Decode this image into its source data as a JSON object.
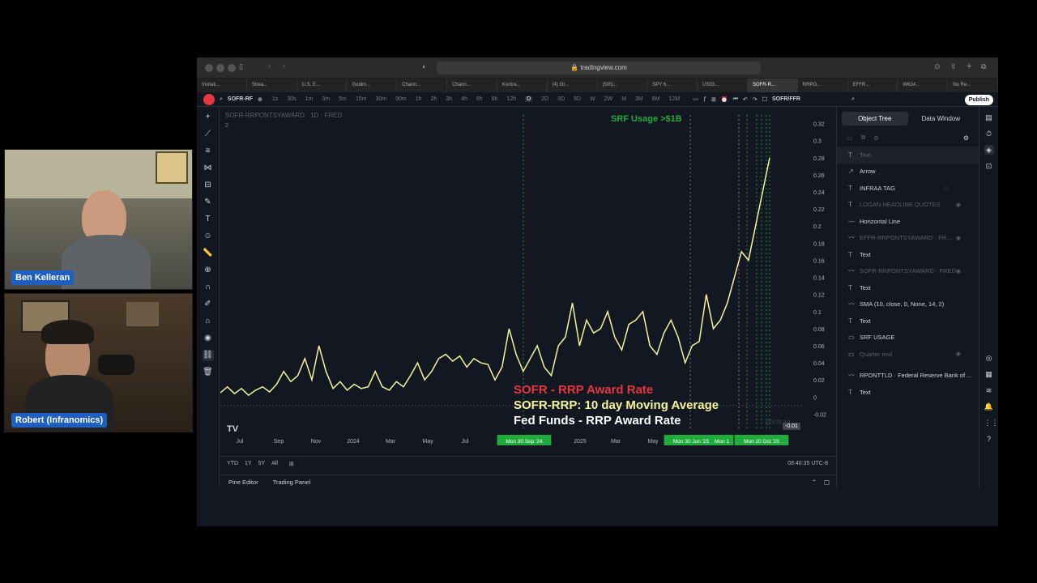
{
  "participants": [
    {
      "name": "Ben Kelleran"
    },
    {
      "name": "Robert (Infranomics)"
    }
  ],
  "browser": {
    "url": "tradingview.com",
    "tabs": [
      "Invitati...",
      "Strea...",
      "U.S. E...",
      "Goldm...",
      "Chann...",
      "Chann...",
      "Kontra...",
      "(4) Gr...",
      "(505)...",
      "SPY 6...",
      "US03...",
      "SOFR-R...",
      "RRPO...",
      "EFFR...",
      "W624...",
      "No Re..."
    ]
  },
  "toolbar": {
    "symbol": "SOFR-RF",
    "intervals": [
      "1s",
      "30s",
      "1m",
      "3m",
      "5m",
      "15m",
      "30m",
      "90m",
      "1h",
      "2h",
      "3h",
      "4h",
      "6h",
      "8h",
      "12h",
      "D",
      "2D",
      "3D",
      "5D",
      "W",
      "2W",
      "M",
      "3M",
      "6M",
      "12M"
    ],
    "active_interval": "D",
    "compare_symbol": "SOFR/FFR",
    "publish_label": "Publish"
  },
  "chart": {
    "legend_title": "SOFR-RRPONTSYAWARD · 1D · FRED",
    "pane_badge": "2",
    "annotation_top": "SRF Usage >$1B",
    "legend_lines": [
      {
        "text": "SOFR - RRP Award Rate",
        "color": "#e8373d"
      },
      {
        "text": "SOFR-RRP: 10 day Moving Average",
        "color": "#f5f59a"
      },
      {
        "text": "Fed Funds - RRP Award Rate",
        "color": "#ffffff"
      }
    ],
    "watermark": "@infraa_",
    "current_value_label": "-0.01",
    "time_label": "08:40:35 UTC-8",
    "timeframe_buttons": [
      "YTD",
      "1Y",
      "5Y",
      "All"
    ]
  },
  "chart_data": {
    "type": "line",
    "ylim": [
      -0.03,
      0.33
    ],
    "yticks": [
      "0.32",
      "0.3",
      "0.28",
      "0.26",
      "0.24",
      "0.22",
      "0.2",
      "0.18",
      "0.16",
      "0.14",
      "0.12",
      "0.1",
      "0.08",
      "0.06",
      "0.04",
      "0.02",
      "0",
      "-0.02"
    ],
    "xticks": [
      "Jul",
      "Sep",
      "Nov",
      "2024",
      "Mar",
      "May",
      "Jul",
      "Mon 30 Sep '24",
      "2025",
      "Mar",
      "May",
      "Mon 30 Jun '25",
      "Mon 1",
      "Mon 20 Oct '25"
    ],
    "series": [
      {
        "color": "#f5f59a",
        "values": [
          0.005,
          0.012,
          0.004,
          0.01,
          0.002,
          0.008,
          0.012,
          0.006,
          0.015,
          0.03,
          0.018,
          0.025,
          0.045,
          0.02,
          0.06,
          0.03,
          0.01,
          0.018,
          0.008,
          0.015,
          0.01,
          0.012,
          0.03,
          0.012,
          0.008,
          0.018,
          0.012,
          0.025,
          0.04,
          0.02,
          0.03,
          0.045,
          0.05,
          0.042,
          0.048,
          0.035,
          0.045,
          0.04,
          0.038,
          0.02,
          0.035,
          0.08,
          0.05,
          0.03,
          0.045,
          0.06,
          0.035,
          0.025,
          0.06,
          0.07,
          0.11,
          0.06,
          0.09,
          0.075,
          0.08,
          0.1,
          0.07,
          0.055,
          0.085,
          0.09,
          0.1,
          0.06,
          0.05,
          0.075,
          0.09,
          0.07,
          0.04,
          0.06,
          0.065,
          0.12,
          0.08,
          0.09,
          0.11,
          0.14,
          0.17,
          0.16,
          0.2,
          0.24,
          0.28
        ]
      }
    ]
  },
  "object_tree": {
    "tabs": [
      "Object Tree",
      "Data Window"
    ],
    "items": [
      {
        "label": "Text",
        "dim": true,
        "icon": "T"
      },
      {
        "label": "Arrow",
        "dim": false,
        "icon": "↗"
      },
      {
        "label": "INFRAA TAG",
        "dim": false,
        "icon": "T",
        "lock": true
      },
      {
        "label": "LOGAN HEADLINE QUOTES",
        "dim": true,
        "icon": "T",
        "eye": true
      },
      {
        "label": "Horizontal Line",
        "dim": false,
        "icon": "—"
      },
      {
        "label": "EFFR-RRPONTSYAWARD · FR...",
        "dim": true,
        "icon": "〰",
        "eye": true
      },
      {
        "label": "Text",
        "dim": false,
        "icon": "T"
      },
      {
        "label": "SOFR-RRPONTSYAWARD · FRED...",
        "dim": true,
        "icon": "〰",
        "eye": true
      },
      {
        "label": "Text",
        "dim": false,
        "icon": "T"
      },
      {
        "label": "SMA (10, close, 0, None, 14, 2)",
        "dim": false,
        "icon": "〰"
      },
      {
        "label": "Text",
        "dim": false,
        "icon": "T"
      },
      {
        "label": "SRF USAGE",
        "dim": false,
        "icon": "▭"
      },
      {
        "label": "Quarter end",
        "dim": true,
        "icon": "▭",
        "eye": true
      },
      {
        "label": "RPONTTLD · Federal Reserve Bank of ...",
        "dim": false,
        "icon": "〰"
      },
      {
        "label": "Text",
        "dim": false,
        "icon": "T"
      }
    ]
  },
  "bottom_panel": {
    "pine_editor": "Pine Editor",
    "trading_panel": "Trading Panel"
  }
}
